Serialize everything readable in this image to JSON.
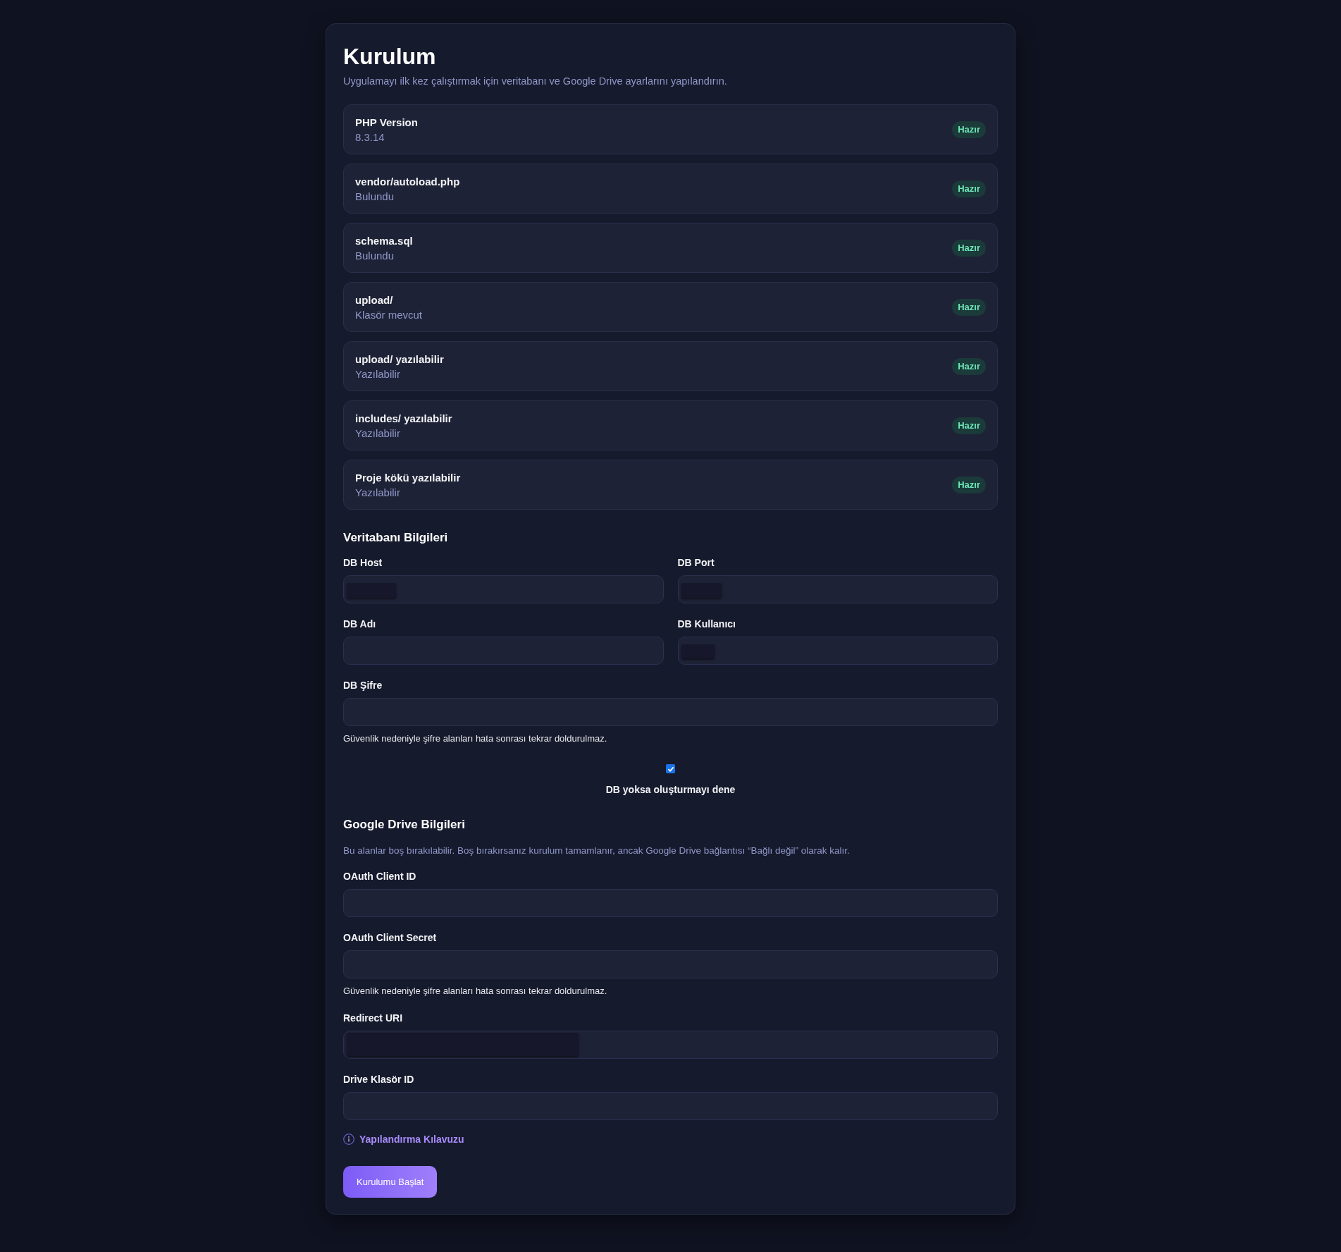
{
  "header": {
    "title": "Kurulum",
    "subtitle": "Uygulamayı ilk kez çalıştırmak için veritabanı ve Google Drive ayarlarını yapılandırın."
  },
  "checks": [
    {
      "name": "PHP Version",
      "detail": "8.3.14",
      "status": "Hazır",
      "ok": true
    },
    {
      "name": "vendor/autoload.php",
      "detail": "Bulundu",
      "status": "Hazır",
      "ok": true
    },
    {
      "name": "schema.sql",
      "detail": "Bulundu",
      "status": "Hazır",
      "ok": true
    },
    {
      "name": "upload/",
      "detail": "Klasör mevcut",
      "status": "Hazır",
      "ok": true
    },
    {
      "name": "upload/ yazılabilir",
      "detail": "Yazılabilir",
      "status": "Hazır",
      "ok": true
    },
    {
      "name": "includes/ yazılabilir",
      "detail": "Yazılabilir",
      "status": "Hazır",
      "ok": true
    },
    {
      "name": "Proje kökü yazılabilir",
      "detail": "Yazılabilir",
      "status": "Hazır",
      "ok": true
    }
  ],
  "database": {
    "heading": "Veritabanı Bilgileri",
    "rows": [
      [
        {
          "label": "DB Host",
          "kind": "maskmedium"
        },
        {
          "label": "DB Port",
          "kind": "masksmall"
        }
      ],
      [
        {
          "label": "DB Adı",
          "kind": "empty"
        },
        {
          "label": "DB Kullanıcı",
          "kind": "masktiny"
        }
      ],
      [
        {
          "label": "DB Şifre",
          "kind": "empty",
          "hint": "Güvenlik nedeniyle şifre alanları hata sonrası tekrar doldurulmaz."
        }
      ]
    ],
    "create_db": {
      "label": "DB yoksa oluşturmayı dene",
      "checked": true
    }
  },
  "drive": {
    "heading": "Google Drive Bilgileri",
    "description": "Bu alanlar boş bırakılabilir. Boş bırakırsanız kurulum tamamlanır, ancak Google Drive bağlantısı “Bağlı değil” olarak kalır.",
    "fields": [
      {
        "label": "OAuth Client ID",
        "kind": "empty"
      },
      {
        "label": "OAuth Client Secret",
        "kind": "empty",
        "hint": "Güvenlik nedeniyle şifre alanları hata sonrası tekrar doldurulmaz."
      },
      {
        "label": "Redirect URI",
        "kind": "masklong"
      },
      {
        "label": "Drive Klasör ID",
        "kind": "empty"
      }
    ],
    "guide_link": "Yapılandırma Kılavuzu"
  },
  "submit_button": "Kurulumu Başlat"
}
